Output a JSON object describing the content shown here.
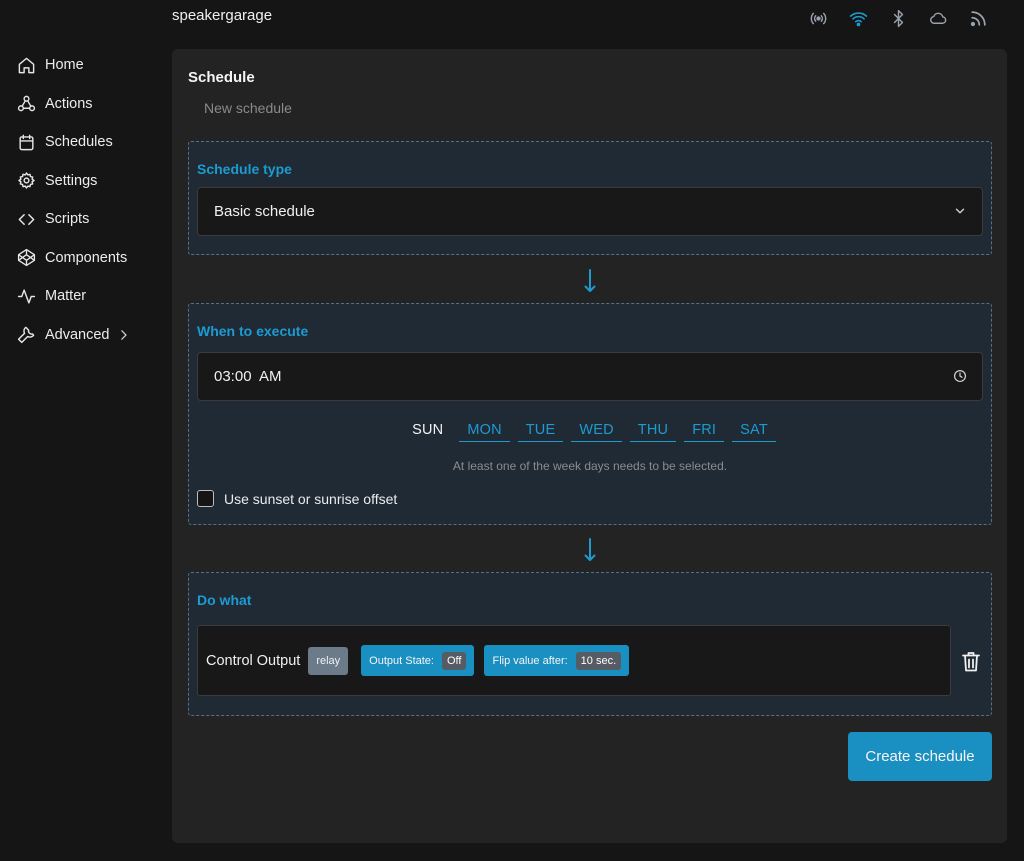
{
  "header": {
    "device_name": "speakergarage",
    "status_icons": [
      "signal-icon",
      "wifi-icon",
      "bluetooth-icon",
      "cloud-icon",
      "rss-icon"
    ]
  },
  "sidebar": {
    "items": [
      {
        "label": "Home",
        "icon": "home-icon"
      },
      {
        "label": "Actions",
        "icon": "webhook-icon"
      },
      {
        "label": "Schedules",
        "icon": "calendar-icon"
      },
      {
        "label": "Settings",
        "icon": "gear-icon"
      },
      {
        "label": "Scripts",
        "icon": "code-icon"
      },
      {
        "label": "Components",
        "icon": "codepen-icon"
      },
      {
        "label": "Matter",
        "icon": "activity-icon"
      },
      {
        "label": "Advanced",
        "icon": "wrench-icon"
      }
    ]
  },
  "main": {
    "title": "Schedule",
    "subtitle": "New schedule",
    "schedule_type": {
      "title": "Schedule type",
      "selected": "Basic schedule"
    },
    "when": {
      "title": "When to execute",
      "time_value": "03:00  AM",
      "days": [
        "SUN",
        "MON",
        "TUE",
        "WED",
        "THU",
        "FRI",
        "SAT"
      ],
      "active_day": "SUN",
      "hint": "At least one of the week days needs to be selected.",
      "offset_label": "Use sunset or sunrise offset",
      "offset_checked": false
    },
    "do_what": {
      "title": "Do what",
      "action_label": "Control Output",
      "tag": "relay",
      "output_state_label": "Output State:",
      "output_state_value": "Off",
      "flip_label": "Flip value after:",
      "flip_value": "10 sec."
    },
    "create_button": "Create schedule"
  },
  "colors": {
    "accent": "#1a8fc2",
    "panel_bg": "#232323",
    "section_bg": "#1f2a35"
  }
}
